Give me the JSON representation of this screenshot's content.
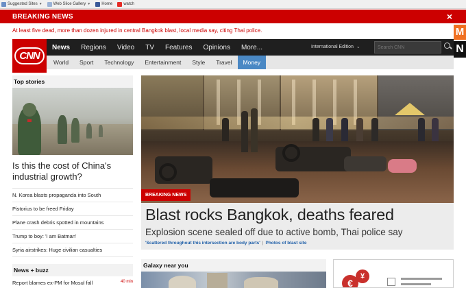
{
  "bookmarks": [
    "Suggested Sites",
    "Web Slice Gallery",
    "Home",
    "watch"
  ],
  "breaking": {
    "label": "BREAKING NEWS",
    "close": "×",
    "text": "At least five dead, more than dozen injured in central Bangkok blast, local media say, citing Thai police."
  },
  "side_logo": {
    "top": "M",
    "bottom": "N"
  },
  "nav": {
    "logo": "CNN",
    "main_items": [
      "News",
      "Regions",
      "Video",
      "TV",
      "Features",
      "Opinions",
      "More..."
    ],
    "edition": "International Edition",
    "search_placeholder": "Search CNN",
    "sub_items": [
      "World",
      "Sport",
      "Technology",
      "Entertainment",
      "Style",
      "Travel",
      "Money"
    ]
  },
  "top_stories": {
    "header": "Top stories",
    "headline": "Is this the cost of China's industrial growth?",
    "stories": [
      "N. Korea blasts propaganda into South",
      "Pistorius to be freed Friday",
      "Plane crash debris spotted in mountains",
      "Trump to boy: 'I am Batman'",
      "Syria airstrikes: Huge civilian casualties"
    ]
  },
  "news_buzz": {
    "header": "News + buzz",
    "item": "Report blames ex-PM for Mosul fall",
    "time": "40 min"
  },
  "hero": {
    "badge": "BREAKING NEWS",
    "headline": "Blast rocks Bangkok, deaths feared",
    "subhead": "Explosion scene sealed off due to active bomb, Thai police say",
    "link1": "'Scattered throughout this intersection are body parts'",
    "separator": "|",
    "link2": "Photos of blast site"
  },
  "galaxy": {
    "header": "Galaxy near you"
  },
  "ad": {
    "coin1": "€",
    "coin2": "¥"
  }
}
